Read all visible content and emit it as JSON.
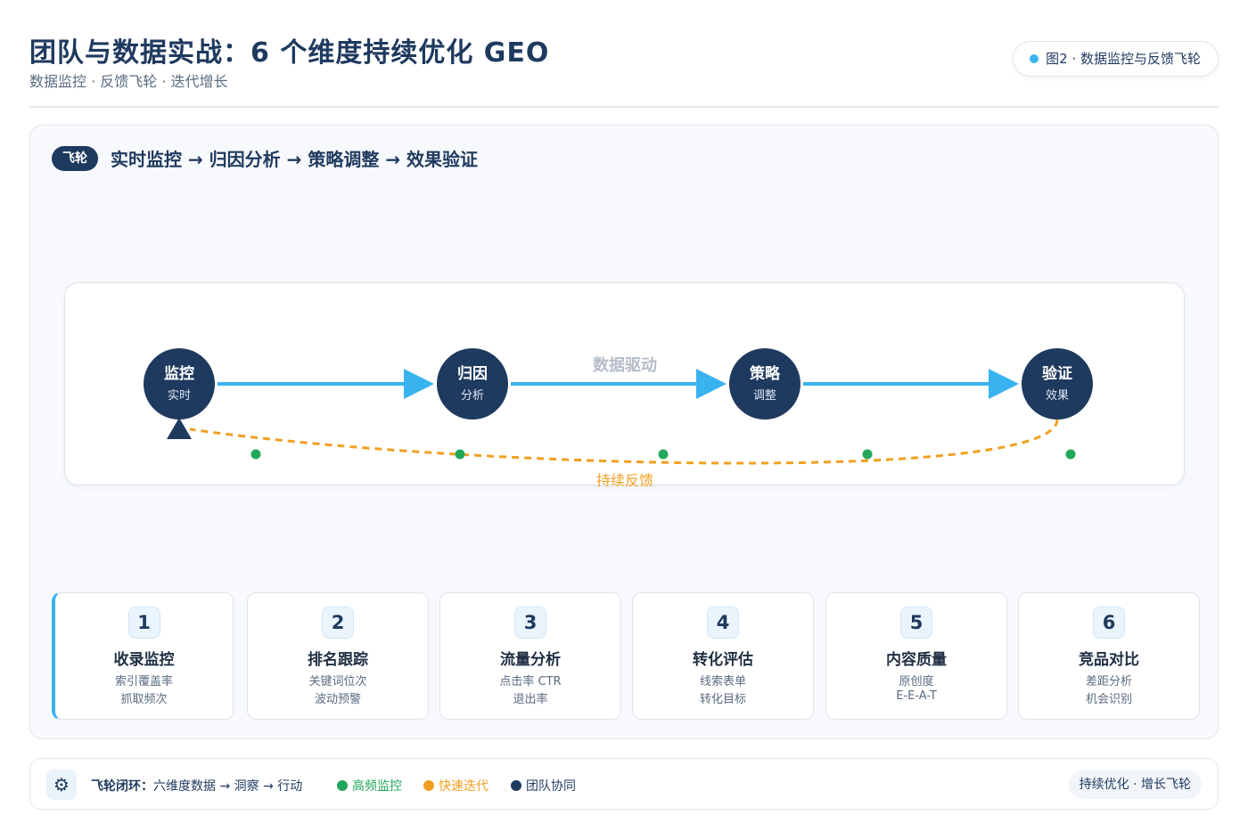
{
  "header": {
    "title": "团队与数据实战：6 个维度持续优化 GEO",
    "subtitle": "数据监控 · 反馈飞轮 · 迭代增长",
    "figure_label": "图2 · 数据监控与反馈飞轮",
    "figure_dot_color": "#39b3ef"
  },
  "flow": {
    "tag": "飞轮",
    "title": "实时监控 → 归因分析 → 策略调整 → 效果验证",
    "center_label": "数据驱动",
    "feedback_label": "持续反馈",
    "nodes": [
      {
        "title": "监控",
        "sub": "实时"
      },
      {
        "title": "归因",
        "sub": "分析"
      },
      {
        "title": "策略",
        "sub": "调整"
      },
      {
        "title": "验证",
        "sub": "效果"
      }
    ],
    "feedback_marker_count": 5,
    "colors": {
      "node": "#1f3a5f",
      "arrow": "#39b3ef",
      "feedback": "#f0a020",
      "marker": "#22a85a"
    }
  },
  "dimensions": [
    {
      "num": "1",
      "title": "收录监控",
      "line1": "索引覆盖率",
      "line2": "抓取频次"
    },
    {
      "num": "2",
      "title": "排名跟踪",
      "line1": "关键词位次",
      "line2": "波动预警"
    },
    {
      "num": "3",
      "title": "流量分析",
      "line1": "点击率 CTR",
      "line2": "退出率"
    },
    {
      "num": "4",
      "title": "转化评估",
      "line1": "线索表单",
      "line2": "转化目标"
    },
    {
      "num": "5",
      "title": "内容质量",
      "line1": "原创度",
      "line2": "E-E-A-T"
    },
    {
      "num": "6",
      "title": "竞品对比",
      "line1": "差距分析",
      "line2": "机会识别"
    }
  ],
  "footer": {
    "gear_icon": "gear-icon",
    "loop_label": "飞轮闭环：",
    "loop_text": "六维度数据 → 洞察 → 行动",
    "legend": [
      {
        "label": "高频监控",
        "color": "#22a85a"
      },
      {
        "label": "快速迭代",
        "color": "#f0a020"
      },
      {
        "label": "团队协同",
        "color": "#1f3a5f"
      }
    ],
    "badge": "持续优化 · 增长飞轮"
  }
}
